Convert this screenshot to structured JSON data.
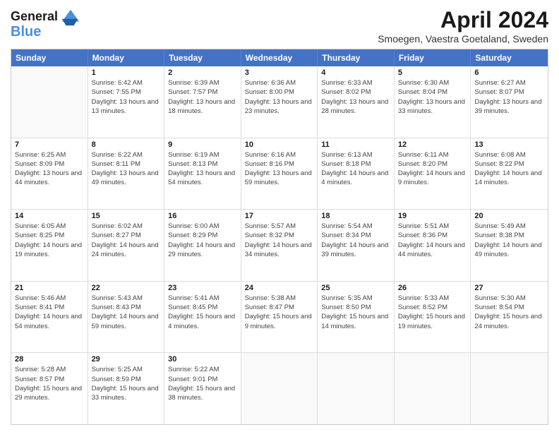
{
  "header": {
    "logo_line1": "General",
    "logo_line2": "Blue",
    "month": "April 2024",
    "location": "Smoegen, Vaestra Goetaland, Sweden"
  },
  "weekdays": [
    "Sunday",
    "Monday",
    "Tuesday",
    "Wednesday",
    "Thursday",
    "Friday",
    "Saturday"
  ],
  "rows": [
    [
      {
        "day": "",
        "sunrise": "",
        "sunset": "",
        "daylight": ""
      },
      {
        "day": "1",
        "sunrise": "Sunrise: 6:42 AM",
        "sunset": "Sunset: 7:55 PM",
        "daylight": "Daylight: 13 hours and 13 minutes."
      },
      {
        "day": "2",
        "sunrise": "Sunrise: 6:39 AM",
        "sunset": "Sunset: 7:57 PM",
        "daylight": "Daylight: 13 hours and 18 minutes."
      },
      {
        "day": "3",
        "sunrise": "Sunrise: 6:36 AM",
        "sunset": "Sunset: 8:00 PM",
        "daylight": "Daylight: 13 hours and 23 minutes."
      },
      {
        "day": "4",
        "sunrise": "Sunrise: 6:33 AM",
        "sunset": "Sunset: 8:02 PM",
        "daylight": "Daylight: 13 hours and 28 minutes."
      },
      {
        "day": "5",
        "sunrise": "Sunrise: 6:30 AM",
        "sunset": "Sunset: 8:04 PM",
        "daylight": "Daylight: 13 hours and 33 minutes."
      },
      {
        "day": "6",
        "sunrise": "Sunrise: 6:27 AM",
        "sunset": "Sunset: 8:07 PM",
        "daylight": "Daylight: 13 hours and 39 minutes."
      }
    ],
    [
      {
        "day": "7",
        "sunrise": "Sunrise: 6:25 AM",
        "sunset": "Sunset: 8:09 PM",
        "daylight": "Daylight: 13 hours and 44 minutes."
      },
      {
        "day": "8",
        "sunrise": "Sunrise: 6:22 AM",
        "sunset": "Sunset: 8:11 PM",
        "daylight": "Daylight: 13 hours and 49 minutes."
      },
      {
        "day": "9",
        "sunrise": "Sunrise: 6:19 AM",
        "sunset": "Sunset: 8:13 PM",
        "daylight": "Daylight: 13 hours and 54 minutes."
      },
      {
        "day": "10",
        "sunrise": "Sunrise: 6:16 AM",
        "sunset": "Sunset: 8:16 PM",
        "daylight": "Daylight: 13 hours and 59 minutes."
      },
      {
        "day": "11",
        "sunrise": "Sunrise: 6:13 AM",
        "sunset": "Sunset: 8:18 PM",
        "daylight": "Daylight: 14 hours and 4 minutes."
      },
      {
        "day": "12",
        "sunrise": "Sunrise: 6:11 AM",
        "sunset": "Sunset: 8:20 PM",
        "daylight": "Daylight: 14 hours and 9 minutes."
      },
      {
        "day": "13",
        "sunrise": "Sunrise: 6:08 AM",
        "sunset": "Sunset: 8:22 PM",
        "daylight": "Daylight: 14 hours and 14 minutes."
      }
    ],
    [
      {
        "day": "14",
        "sunrise": "Sunrise: 6:05 AM",
        "sunset": "Sunset: 8:25 PM",
        "daylight": "Daylight: 14 hours and 19 minutes."
      },
      {
        "day": "15",
        "sunrise": "Sunrise: 6:02 AM",
        "sunset": "Sunset: 8:27 PM",
        "daylight": "Daylight: 14 hours and 24 minutes."
      },
      {
        "day": "16",
        "sunrise": "Sunrise: 6:00 AM",
        "sunset": "Sunset: 8:29 PM",
        "daylight": "Daylight: 14 hours and 29 minutes."
      },
      {
        "day": "17",
        "sunrise": "Sunrise: 5:57 AM",
        "sunset": "Sunset: 8:32 PM",
        "daylight": "Daylight: 14 hours and 34 minutes."
      },
      {
        "day": "18",
        "sunrise": "Sunrise: 5:54 AM",
        "sunset": "Sunset: 8:34 PM",
        "daylight": "Daylight: 14 hours and 39 minutes."
      },
      {
        "day": "19",
        "sunrise": "Sunrise: 5:51 AM",
        "sunset": "Sunset: 8:36 PM",
        "daylight": "Daylight: 14 hours and 44 minutes."
      },
      {
        "day": "20",
        "sunrise": "Sunrise: 5:49 AM",
        "sunset": "Sunset: 8:38 PM",
        "daylight": "Daylight: 14 hours and 49 minutes."
      }
    ],
    [
      {
        "day": "21",
        "sunrise": "Sunrise: 5:46 AM",
        "sunset": "Sunset: 8:41 PM",
        "daylight": "Daylight: 14 hours and 54 minutes."
      },
      {
        "day": "22",
        "sunrise": "Sunrise: 5:43 AM",
        "sunset": "Sunset: 8:43 PM",
        "daylight": "Daylight: 14 hours and 59 minutes."
      },
      {
        "day": "23",
        "sunrise": "Sunrise: 5:41 AM",
        "sunset": "Sunset: 8:45 PM",
        "daylight": "Daylight: 15 hours and 4 minutes."
      },
      {
        "day": "24",
        "sunrise": "Sunrise: 5:38 AM",
        "sunset": "Sunset: 8:47 PM",
        "daylight": "Daylight: 15 hours and 9 minutes."
      },
      {
        "day": "25",
        "sunrise": "Sunrise: 5:35 AM",
        "sunset": "Sunset: 8:50 PM",
        "daylight": "Daylight: 15 hours and 14 minutes."
      },
      {
        "day": "26",
        "sunrise": "Sunrise: 5:33 AM",
        "sunset": "Sunset: 8:52 PM",
        "daylight": "Daylight: 15 hours and 19 minutes."
      },
      {
        "day": "27",
        "sunrise": "Sunrise: 5:30 AM",
        "sunset": "Sunset: 8:54 PM",
        "daylight": "Daylight: 15 hours and 24 minutes."
      }
    ],
    [
      {
        "day": "28",
        "sunrise": "Sunrise: 5:28 AM",
        "sunset": "Sunset: 8:57 PM",
        "daylight": "Daylight: 15 hours and 29 minutes."
      },
      {
        "day": "29",
        "sunrise": "Sunrise: 5:25 AM",
        "sunset": "Sunset: 8:59 PM",
        "daylight": "Daylight: 15 hours and 33 minutes."
      },
      {
        "day": "30",
        "sunrise": "Sunrise: 5:22 AM",
        "sunset": "Sunset: 9:01 PM",
        "daylight": "Daylight: 15 hours and 38 minutes."
      },
      {
        "day": "",
        "sunrise": "",
        "sunset": "",
        "daylight": ""
      },
      {
        "day": "",
        "sunrise": "",
        "sunset": "",
        "daylight": ""
      },
      {
        "day": "",
        "sunrise": "",
        "sunset": "",
        "daylight": ""
      },
      {
        "day": "",
        "sunrise": "",
        "sunset": "",
        "daylight": ""
      }
    ]
  ]
}
